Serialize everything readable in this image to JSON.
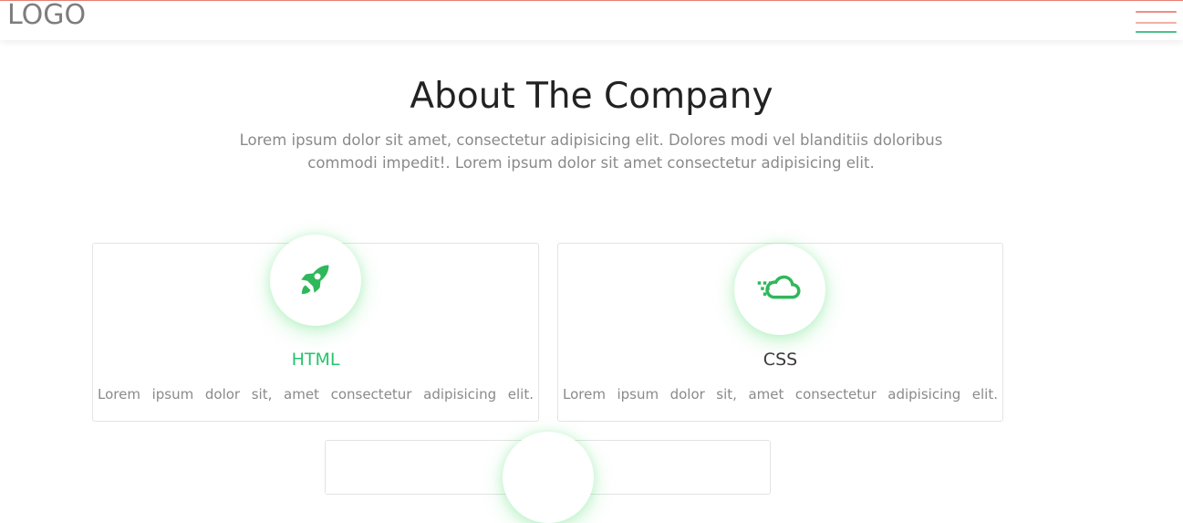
{
  "header": {
    "logo": "LOGO",
    "menu_icon": "hamburger-menu-icon",
    "menu_colors": [
      "#ec8f84",
      "#f0b0a6",
      "#4cbf8a"
    ]
  },
  "about": {
    "title": "About The Company",
    "description": "Lorem ipsum dolor sit amet, consectetur adipisicing elit. Dolores modi vel blanditiis doloribus commodi impedit!. Lorem ipsum dolor sit amet consectetur adipisicing elit."
  },
  "cards": [
    {
      "icon": "rocket-icon",
      "title": "HTML",
      "text": "Lorem ipsum dolor sit, amet consectetur adipisicing elit.",
      "title_color": "#27c46b"
    },
    {
      "icon": "cloud-icon",
      "title": "CSS",
      "text": "Lorem ipsum dolor sit, amet consectetur adipisicing elit.",
      "title_color": "#3a3a3a"
    }
  ],
  "colors": {
    "accent_green": "#27c46b",
    "icon_green": "#2fb85a",
    "text_gray": "#8a8a8a",
    "heading": "#222222"
  }
}
